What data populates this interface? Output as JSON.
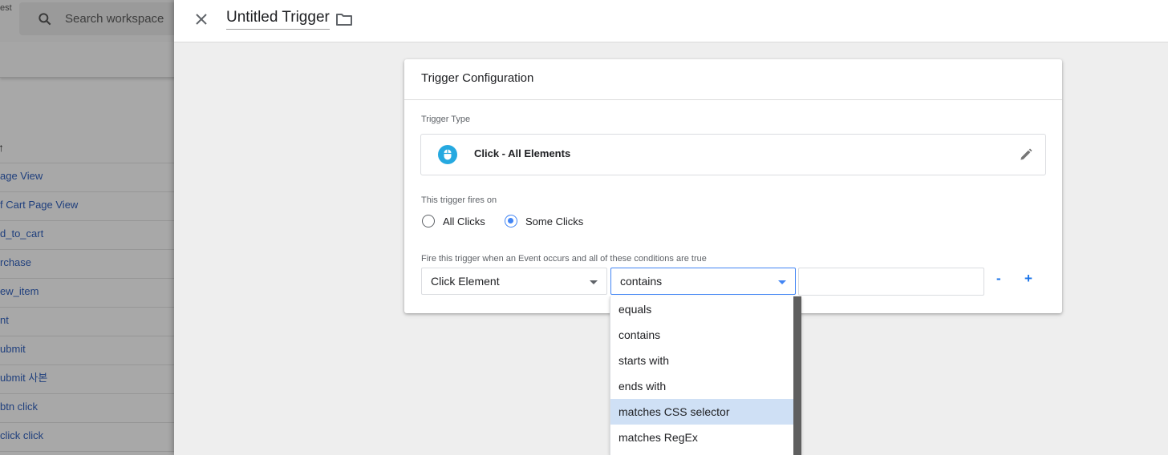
{
  "workspace": {
    "top_left_text": "est",
    "search_placeholder": "Search workspace",
    "sort_indicator": "↑",
    "triggers": [
      "age View",
      "f Cart Page View",
      "d_to_cart",
      "rchase",
      "ew_item",
      "nt",
      "ubmit",
      "ubmit 사본",
      " btn click",
      " click click"
    ]
  },
  "editor": {
    "trigger_name": "Untitled Trigger",
    "card_title": "Trigger Configuration",
    "trigger_type_label": "Trigger Type",
    "trigger_type_value": "Click - All Elements",
    "fires_on_label": "This trigger fires on",
    "radios": [
      {
        "label": "All Clicks",
        "selected": false
      },
      {
        "label": "Some Clicks",
        "selected": true
      }
    ],
    "conditions_label": "Fire this trigger when an Event occurs and all of these conditions are true",
    "condition": {
      "variable": "Click Element",
      "operator": "contains",
      "value": ""
    },
    "remove_label": "-",
    "add_label": "+"
  },
  "operator_dropdown": {
    "options": [
      "equals",
      "contains",
      "starts with",
      "ends with",
      "matches CSS selector",
      "matches RegEx"
    ],
    "highlighted_option": "matches CSS selector"
  },
  "colors": {
    "accent": "#4285f4",
    "link": "#1a73e8",
    "highlight": "#cfe0f5",
    "icon_bg": "#26a9e0"
  }
}
